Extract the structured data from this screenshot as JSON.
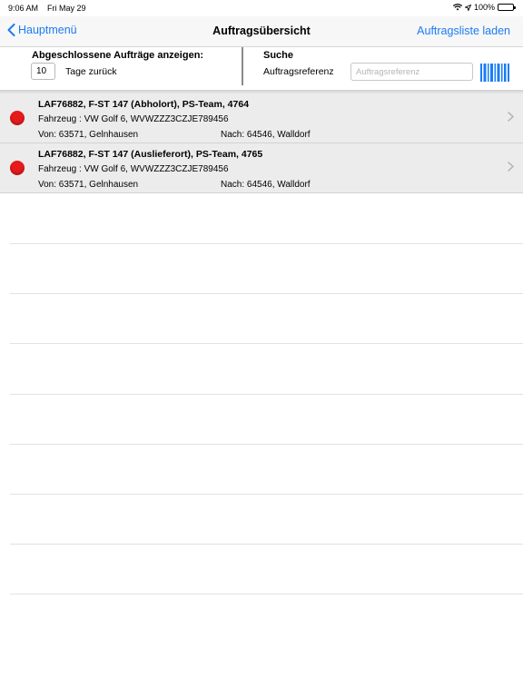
{
  "statusbar": {
    "time": "9:06 AM",
    "date": "Fri May 29",
    "battery": "100%"
  },
  "navbar": {
    "back_label": "Hauptmenü",
    "title": "Auftragsübersicht",
    "right_label": "Auftragsliste laden"
  },
  "filter": {
    "completed_title": "Abgeschlossene Aufträge anzeigen:",
    "days_value": "10",
    "days_label": "Tage zurück",
    "search_title": "Suche",
    "ref_label": "Auftragsreferenz",
    "ref_placeholder": "Auftragsreferenz"
  },
  "orders": [
    {
      "title": "LAF76882, F-ST 147 (Abholort), PS-Team, 4764",
      "vehicle": "Fahrzeug : VW Golf 6, WVWZZZ3CZJE789456",
      "from": "Von: 63571, Gelnhausen",
      "to": "Nach: 64546, Walldorf",
      "status_color": "#e81b1b"
    },
    {
      "title": "LAF76882, F-ST 147 (Auslieferort), PS-Team, 4765",
      "vehicle": "Fahrzeug : VW Golf 6, WVWZZZ3CZJE789456",
      "from": "Von: 63571, Gelnhausen",
      "to": "Nach: 64546, Walldorf",
      "status_color": "#e81b1b"
    }
  ],
  "colors": {
    "accent": "#1a7cf4",
    "status_red": "#e81b1b"
  }
}
